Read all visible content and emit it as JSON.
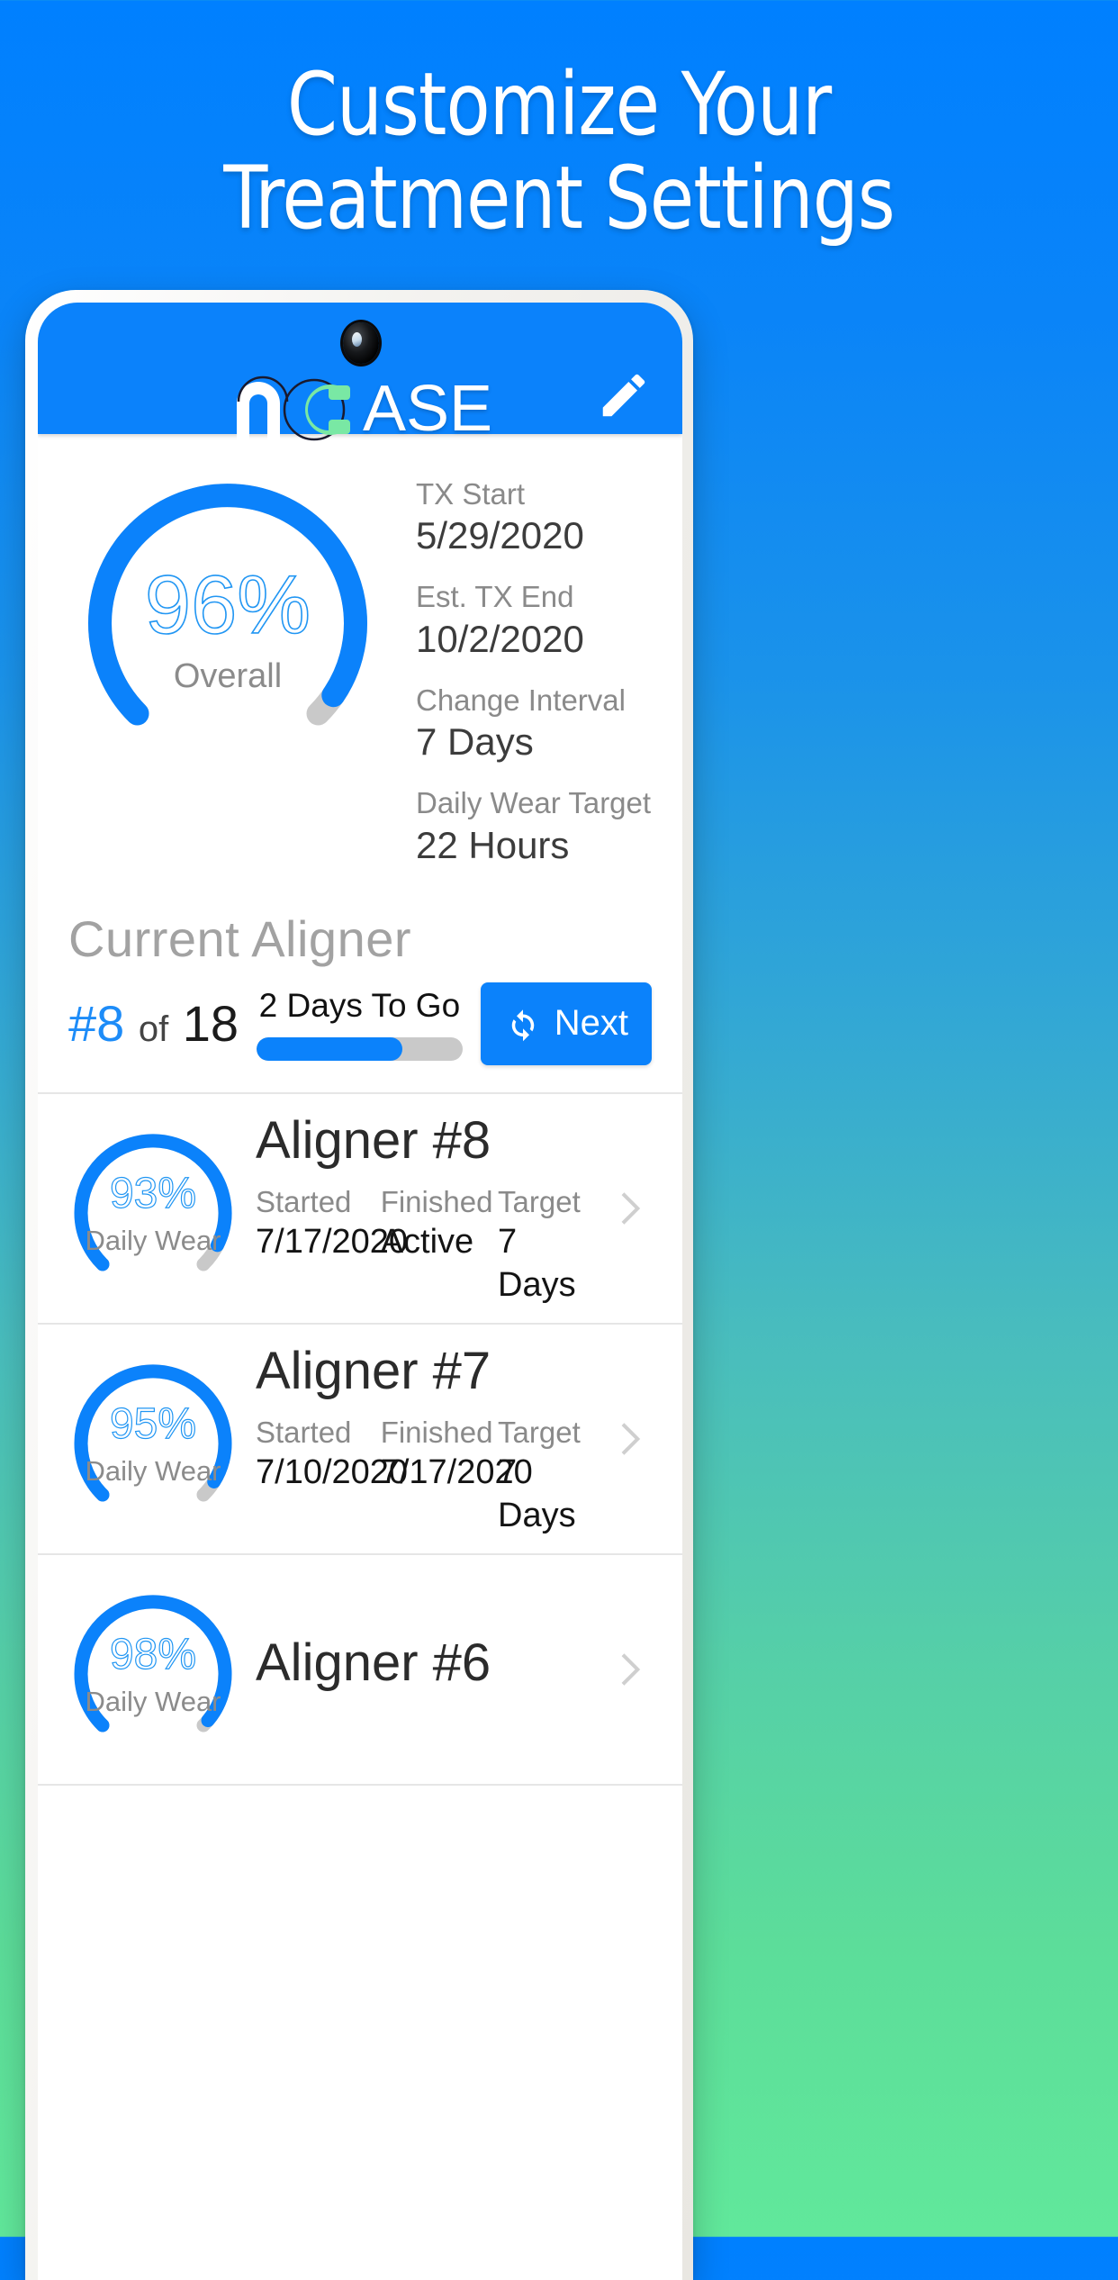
{
  "promo": {
    "headline_line1": "Customize Your",
    "headline_line2": "Treatment Settings"
  },
  "colors": {
    "brand_blue": "#0b82fb",
    "accent_blue": "#1d8cf8",
    "logo_green": "#79e8a4",
    "track_gray": "#c9c9c9",
    "bg_top": "#0080ff",
    "bg_bottom": "#61e89b"
  },
  "appbar": {
    "logo_n": "n",
    "logo_c": "C",
    "logo_rest": "ASE",
    "edit_icon": "pencil-icon",
    "camera": "front-camera"
  },
  "overall": {
    "percent_label": "96%",
    "percent_value": 96,
    "caption": "Overall"
  },
  "treatment_info": [
    {
      "label": "TX Start",
      "value": "5/29/2020"
    },
    {
      "label": "Est. TX End",
      "value": "10/2/2020"
    },
    {
      "label": "Change Interval",
      "value": "7 Days"
    },
    {
      "label": "Daily Wear Target",
      "value": "22 Hours"
    }
  ],
  "current_aligner": {
    "title": "Current Aligner",
    "hash_number": "#8",
    "of_word": "of",
    "total": "18",
    "days_to_go": "2 Days To Go",
    "progress_percent": 71,
    "next_label": "Next",
    "next_icon": "refresh-icon"
  },
  "list_headers": {
    "started": "Started",
    "finished": "Finished",
    "target": "Target"
  },
  "aligners": [
    {
      "title": "Aligner #8",
      "wear_percent_label": "93%",
      "wear_percent": 93,
      "wear_caption": "Daily Wear",
      "started": "7/17/2020",
      "finished": "Active",
      "target": "7 Days"
    },
    {
      "title": "Aligner #7",
      "wear_percent_label": "95%",
      "wear_percent": 95,
      "wear_caption": "Daily Wear",
      "started": "7/10/2020",
      "finished": "7/17/2020",
      "target": "7 Days"
    },
    {
      "title": "Aligner #6",
      "wear_percent_label": "98%",
      "wear_percent": 98,
      "wear_caption": "Daily Wear",
      "started": "",
      "finished": "",
      "target": ""
    }
  ]
}
